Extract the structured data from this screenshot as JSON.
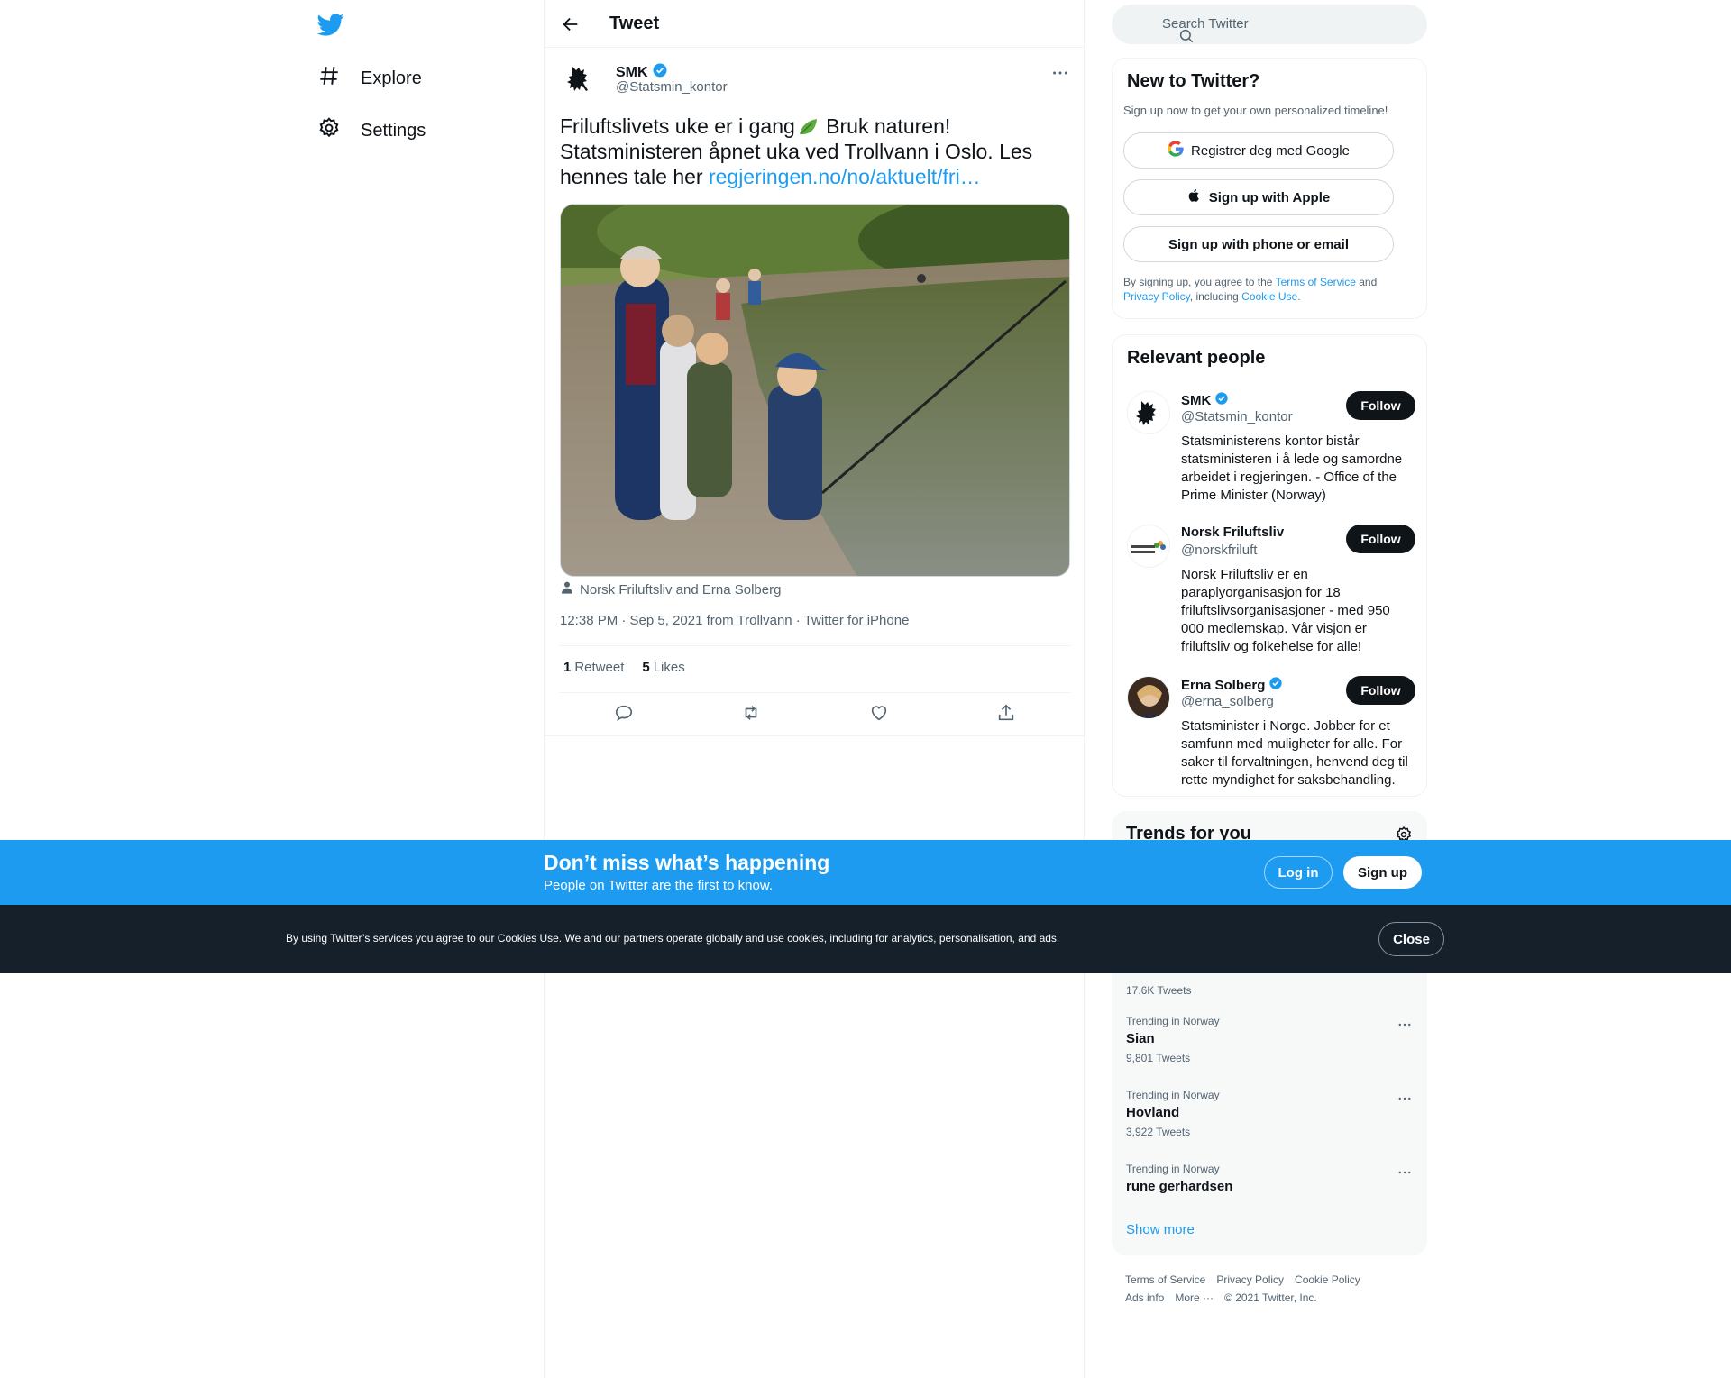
{
  "nav": {
    "items": [
      {
        "label": "Explore",
        "icon": "hashtag-icon"
      },
      {
        "label": "Settings",
        "icon": "gear-icon"
      }
    ]
  },
  "header": {
    "title": "Tweet"
  },
  "tweet": {
    "author_name": "SMK",
    "author_handle": "@Statsmin_kontor",
    "text_before": "Friluftslivets uke er i gang",
    "text_after": " Bruk naturen! Statsministeren åpnet uka ved Trollvann i Oslo. Les hennes tale her ",
    "link": "regjeringen.no/no/aktuelt/fri…",
    "tagged": "Norsk Friluftsliv and Erna Solberg",
    "meta": "12:38 PM · Sep 5, 2021 from Trollvann · Twitter for iPhone",
    "retweets_count": "1",
    "retweets_label": "Retweet",
    "likes_count": "5",
    "likes_label": "Likes"
  },
  "search": {
    "placeholder": "Search Twitter"
  },
  "signup": {
    "title": "New to Twitter?",
    "subtitle": "Sign up now to get your own personalized timeline!",
    "google": "Registrer deg med Google",
    "apple": "Sign up with Apple",
    "phone": "Sign up with phone or email",
    "legal_1": "By signing up, you agree to the ",
    "tos": "Terms of Service",
    "legal_2": " and ",
    "privacy": "Privacy Policy",
    "legal_3": ", including ",
    "cookie": "Cookie Use."
  },
  "people": {
    "title": "Relevant people",
    "follow_label": "Follow",
    "list": [
      {
        "name": "SMK",
        "handle": "@Statsmin_kontor",
        "verified": true,
        "bio": "Statsministerens kontor bistår statsministeren i å lede og samordne arbeidet i regjeringen. - Office of the Prime Minister (Norway)"
      },
      {
        "name": "Norsk Friluftsliv",
        "handle": "@norskfriluft",
        "verified": false,
        "bio": "Norsk Friluftsliv er en paraplyorganisasjon for 18 friluftslivsorganisasjoner - med 950 000 medlemskap. Vår visjon er friluftsliv og folkehelse for alle!"
      },
      {
        "name": "Erna Solberg",
        "handle": "@erna_solberg",
        "verified": true,
        "bio": "Statsminister i Norge. Jobber for et samfunn med muligheter for alle. For saker til forvaltningen, henvend deg til rette myndighet for saksbehandling."
      }
    ]
  },
  "trends": {
    "title": "Trends for you",
    "partial_count": "17.6K Tweets",
    "items": [
      {
        "context": "Trending in Norway",
        "name": "Sian",
        "count": "9,801 Tweets"
      },
      {
        "context": "Trending in Norway",
        "name": "Hovland",
        "count": "3,922 Tweets"
      },
      {
        "context": "Trending in Norway",
        "name": "rune gerhardsen",
        "count": ""
      }
    ],
    "show_more": "Show more"
  },
  "footer": {
    "tos": "Terms of Service",
    "privacy": "Privacy Policy",
    "cookie": "Cookie Policy",
    "ads": "Ads info",
    "more": "More ···",
    "copyright": "© 2021 Twitter, Inc."
  },
  "bottom_bar": {
    "title": "Don’t miss what’s happening",
    "subtitle": "People on Twitter are the first to know.",
    "login": "Log in",
    "signup": "Sign up"
  },
  "cookie_bar": {
    "text": "By using Twitter’s services you agree to our Cookies Use. We and our partners operate globally and use cookies, including for analytics, personalisation, and ads.",
    "close": "Close"
  },
  "colors": {
    "accent": "#1d9bf0",
    "text": "#0f1419",
    "muted": "#536471",
    "cookie_bg": "#15202b"
  }
}
